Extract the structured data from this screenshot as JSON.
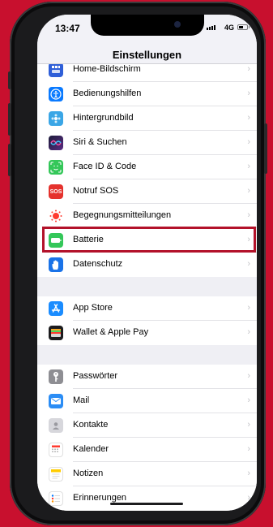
{
  "status": {
    "time": "13:47",
    "network": "4G"
  },
  "nav": {
    "title": "Einstellungen"
  },
  "colors": {
    "background": "#c8102e",
    "highlight": "#b3122a"
  },
  "groups": [
    {
      "items": [
        {
          "label": "Home-Bildschirm",
          "icon": "home-screen-icon",
          "color": "#2f5fd8"
        },
        {
          "label": "Bedienungshilfen",
          "icon": "accessibility-icon",
          "color": "#0a7aff"
        },
        {
          "label": "Hintergrundbild",
          "icon": "wallpaper-icon",
          "color": "#3aa6e6"
        },
        {
          "label": "Siri & Suchen",
          "icon": "siri-icon",
          "color": "#2b2b52"
        },
        {
          "label": "Face ID & Code",
          "icon": "face-id-icon",
          "color": "#34c759"
        },
        {
          "label": "Notruf SOS",
          "icon": "sos-icon",
          "color": "#e5322d"
        },
        {
          "label": "Begegnungsmitteilungen",
          "icon": "exposure-notification-icon",
          "color": "#ffffff"
        },
        {
          "label": "Batterie",
          "icon": "battery-icon",
          "color": "#34c759"
        },
        {
          "label": "Datenschutz",
          "icon": "privacy-hand-icon",
          "color": "#1a73e8"
        }
      ]
    },
    {
      "items": [
        {
          "label": "App Store",
          "icon": "app-store-icon",
          "color": "#1a8cff"
        },
        {
          "label": "Wallet & Apple Pay",
          "icon": "wallet-icon",
          "color": "#1c1c1e"
        }
      ]
    },
    {
      "items": [
        {
          "label": "Passwörter",
          "icon": "key-icon",
          "color": "#8e8e93"
        },
        {
          "label": "Mail",
          "icon": "mail-icon",
          "color": "#2b8df5"
        },
        {
          "label": "Kontakte",
          "icon": "contacts-icon",
          "color": "#d7d7dc"
        },
        {
          "label": "Kalender",
          "icon": "calendar-icon",
          "color": "#ffffff"
        },
        {
          "label": "Notizen",
          "icon": "notes-icon",
          "color": "#ffffff"
        },
        {
          "label": "Erinnerungen",
          "icon": "reminders-icon",
          "color": "#ffffff"
        }
      ]
    }
  ]
}
